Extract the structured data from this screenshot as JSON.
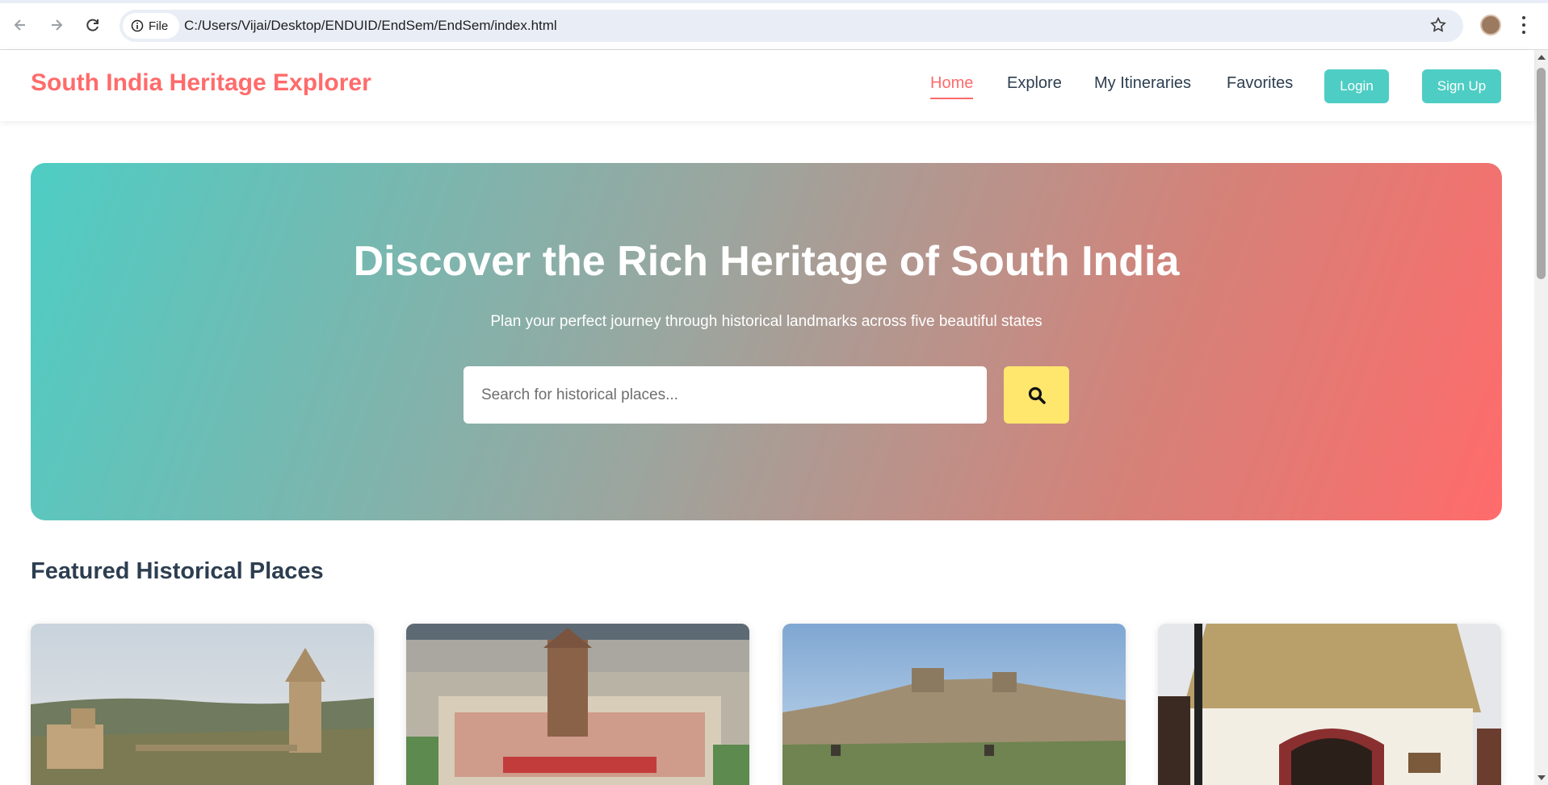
{
  "browser": {
    "site_chip": "File",
    "url": "C:/Users/Vijai/Desktop/ENDUID/EndSem/EndSem/index.html"
  },
  "header": {
    "logo": "South India Heritage Explorer",
    "nav": {
      "home": "Home",
      "explore": "Explore",
      "itineraries": "My Itineraries",
      "favorites": "Favorites"
    },
    "login": "Login",
    "signup": "Sign Up"
  },
  "hero": {
    "title": "Discover the Rich Heritage of South India",
    "subtitle": "Plan your perfect journey through historical landmarks across five beautiful states",
    "search_placeholder": "Search for historical places..."
  },
  "featured": {
    "title": "Featured Historical Places"
  },
  "colors": {
    "accent": "#ff6b6b",
    "teal": "#4ecdc4",
    "yellow": "#ffe66d",
    "heading": "#2d3e50"
  }
}
